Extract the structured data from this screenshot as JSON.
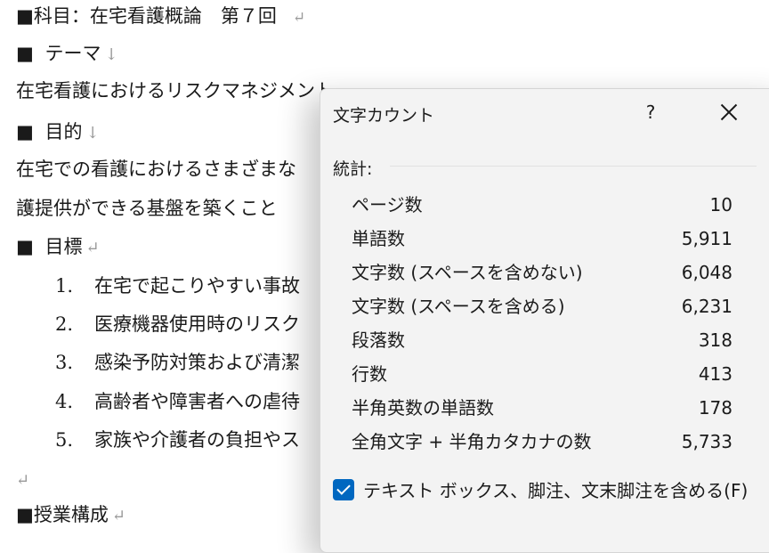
{
  "document": {
    "course_title": "■科目：在宅看護概論　第７回",
    "theme_heading": "テーマ",
    "theme_text": "在宅看護におけるリスクマネジメント",
    "purpose_heading": "目的",
    "purpose_text_1": "在宅での看護におけるさまざまな",
    "purpose_text_2": "護提供ができる基盤を築くこと",
    "goals_heading": "目標",
    "goals": [
      {
        "num": "1.",
        "text": "在宅で起こりやすい事故"
      },
      {
        "num": "2.",
        "text": "医療機器使用時のリスク"
      },
      {
        "num": "3.",
        "text": "感染予防対策および清潔"
      },
      {
        "num": "4.",
        "text": "高齢者や障害者への虐待"
      },
      {
        "num": "5.",
        "text": "家族や介護者の負担やス"
      }
    ],
    "structure_heading": "■授業構成"
  },
  "dialog": {
    "title": "文字カウント",
    "help_label": "?",
    "section_label": "統計:",
    "stats": [
      {
        "label": "ページ数",
        "value": "10"
      },
      {
        "label": "単語数",
        "value": "5,911"
      },
      {
        "label": "文字数 (スペースを含めない)",
        "value": "6,048"
      },
      {
        "label": "文字数 (スペースを含める)",
        "value": "6,231"
      },
      {
        "label": "段落数",
        "value": "318"
      },
      {
        "label": "行数",
        "value": "413"
      },
      {
        "label": "半角英数の単語数",
        "value": "178"
      },
      {
        "label": "全角文字 + 半角カタカナの数",
        "value": "5,733"
      }
    ],
    "checkbox_label": "テキスト ボックス、脚注、文末脚注を含める(F)",
    "checkbox_checked": true,
    "accent_color": "#0067c0"
  }
}
